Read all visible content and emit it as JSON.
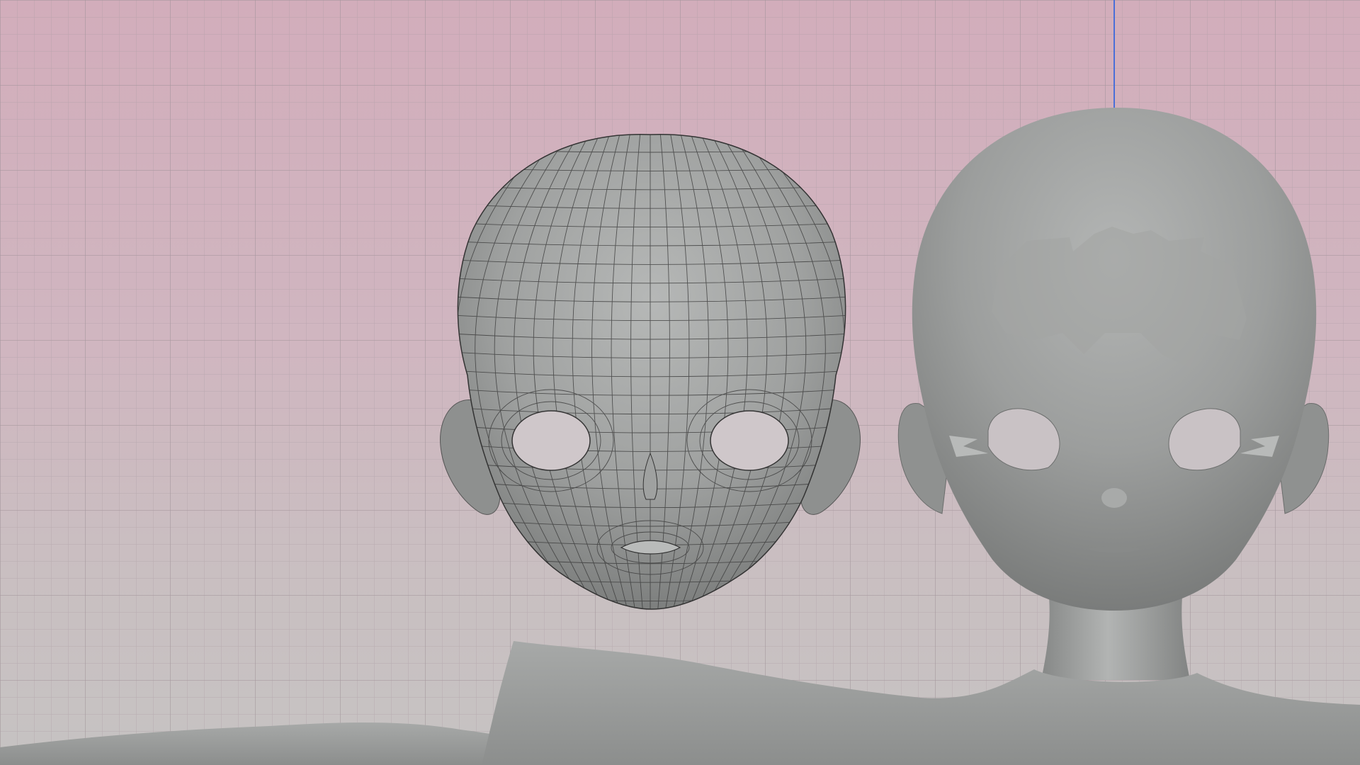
{
  "viewport": {
    "background_top": "#d2adbb",
    "background_bottom": "#c6c3c2",
    "grid_color": "#a99aa1",
    "axis_line_color": "#4a6fd8",
    "mesh_fill": "#9a9c9b",
    "wire_color": "#3a3a3a"
  },
  "objects": [
    {
      "name": "head-topology-wireframe",
      "mode": "wireframe-on-shaded"
    },
    {
      "name": "head-sculpt-reference",
      "mode": "solid-shaded"
    },
    {
      "name": "body-base-mesh",
      "mode": "solid-shaded"
    }
  ]
}
